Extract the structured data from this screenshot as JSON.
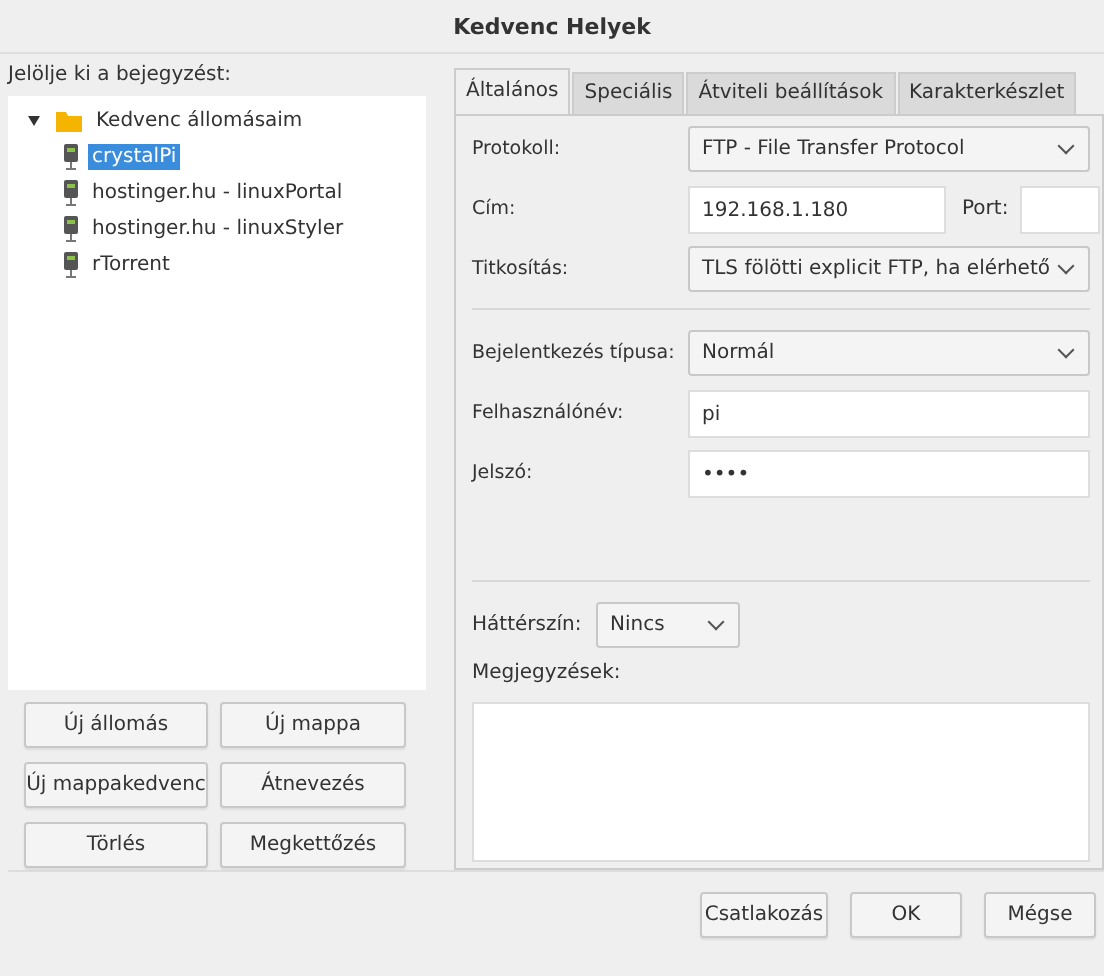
{
  "window": {
    "title": "Kedvenc Helyek"
  },
  "tree": {
    "label": "Jelölje ki a bejegyzést:",
    "items": [
      {
        "label": "Kedvenc állomásaim",
        "kind": "folder",
        "expanded": true,
        "selected": false,
        "children": [
          {
            "label": "crystalPi",
            "kind": "site",
            "selected": true
          },
          {
            "label": "hostinger.hu - linuxPortal",
            "kind": "site",
            "selected": false
          },
          {
            "label": "hostinger.hu - linuxStyler",
            "kind": "site",
            "selected": false
          },
          {
            "label": "rTorrent",
            "kind": "site",
            "selected": false
          }
        ]
      }
    ]
  },
  "left_buttons": [
    "Új állomás",
    "Új mappa",
    "Új mappakedvenc",
    "Átnevezés",
    "Törlés",
    "Megkettőzés"
  ],
  "tabs": [
    {
      "label": "Általános",
      "selected": true
    },
    {
      "label": "Speciális",
      "selected": false
    },
    {
      "label": "Átviteli beállítások",
      "selected": false
    },
    {
      "label": "Karakterkészlet",
      "selected": false
    }
  ],
  "form": {
    "protocol": {
      "label": "Protokoll:",
      "value": "FTP - File Transfer Protocol"
    },
    "host": {
      "label": "Cím:",
      "value": "192.168.1.180"
    },
    "port": {
      "label": "Port:"
    },
    "encryption": {
      "label": "Titkosítás:",
      "value": "TLS fölötti explicit FTP, ha elérhető"
    },
    "logon_type": {
      "label": "Bejelentkezés típusa:",
      "value": "Normál"
    },
    "user": {
      "label": "Felhasználónév:",
      "value": "pi"
    },
    "password": {
      "label": "Jelszó:",
      "value": "••••"
    },
    "background": {
      "label": "Háttérszín:",
      "value": "Nincs"
    },
    "comments": {
      "label": "Megjegyzések:"
    }
  },
  "dialog_buttons": [
    "Csatlakozás",
    "OK",
    "Mégse"
  ]
}
